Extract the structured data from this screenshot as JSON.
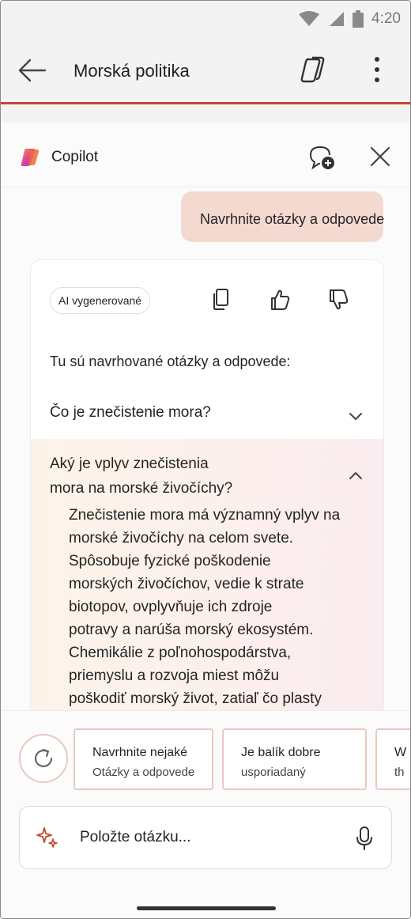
{
  "status_bar": {
    "time": "4:20",
    "icons": [
      "wifi-icon",
      "signal-icon",
      "battery-icon"
    ]
  },
  "app_bar": {
    "title": "Morská politika",
    "icons": [
      "back-arrow-icon",
      "copilot-icon",
      "more-vertical-icon"
    ]
  },
  "copilot": {
    "name": "Copilot",
    "header_icons": [
      "copilot-logo-icon",
      "new-chat-icon",
      "close-icon"
    ],
    "user_message": "Navrhnite otázky a odpovede",
    "response": {
      "badge": "AI vygenerované",
      "actions": [
        "copy-icon",
        "thumbs-up-icon",
        "thumbs-down-icon"
      ],
      "intro": "Tu sú navrhované otázky a odpovede:",
      "questions": [
        {
          "question": "Čo je znečistenie mora?",
          "expanded": false
        },
        {
          "question_line1": "Aký je vplyv znečistenia",
          "question_line2": "mora na morské živočíchy?",
          "expanded": true,
          "answer_lines": [
            "Znečistenie mora má významný vplyv na",
            "morské živočíchy na celom svete.",
            "Spôsobuje fyzické poškodenie",
            "morských živočíchov, vedie k strate",
            "biotopov, ovplyvňuje ich zdroje",
            "potravy a narúša morský ekosystém.",
            "Chemikálie z poľnohospodárstva,",
            "priemyslu a rozvoja miest môžu",
            "poškodiť morský život, zatiaľ čo plasty"
          ]
        }
      ]
    },
    "suggestions": [
      {
        "line1": "Navrhnite nejaké",
        "line2": "Otázky a odpovede"
      },
      {
        "line1": "Je balík dobre",
        "line2": "usporiadaný"
      },
      {
        "line1": "W",
        "line2": "th"
      }
    ],
    "input": {
      "placeholder": "Položte otázku..."
    },
    "colors": {
      "accent": "#c4462e",
      "user_bubble": "#f4d9d1",
      "chip_border": "#e8c9c0"
    }
  }
}
